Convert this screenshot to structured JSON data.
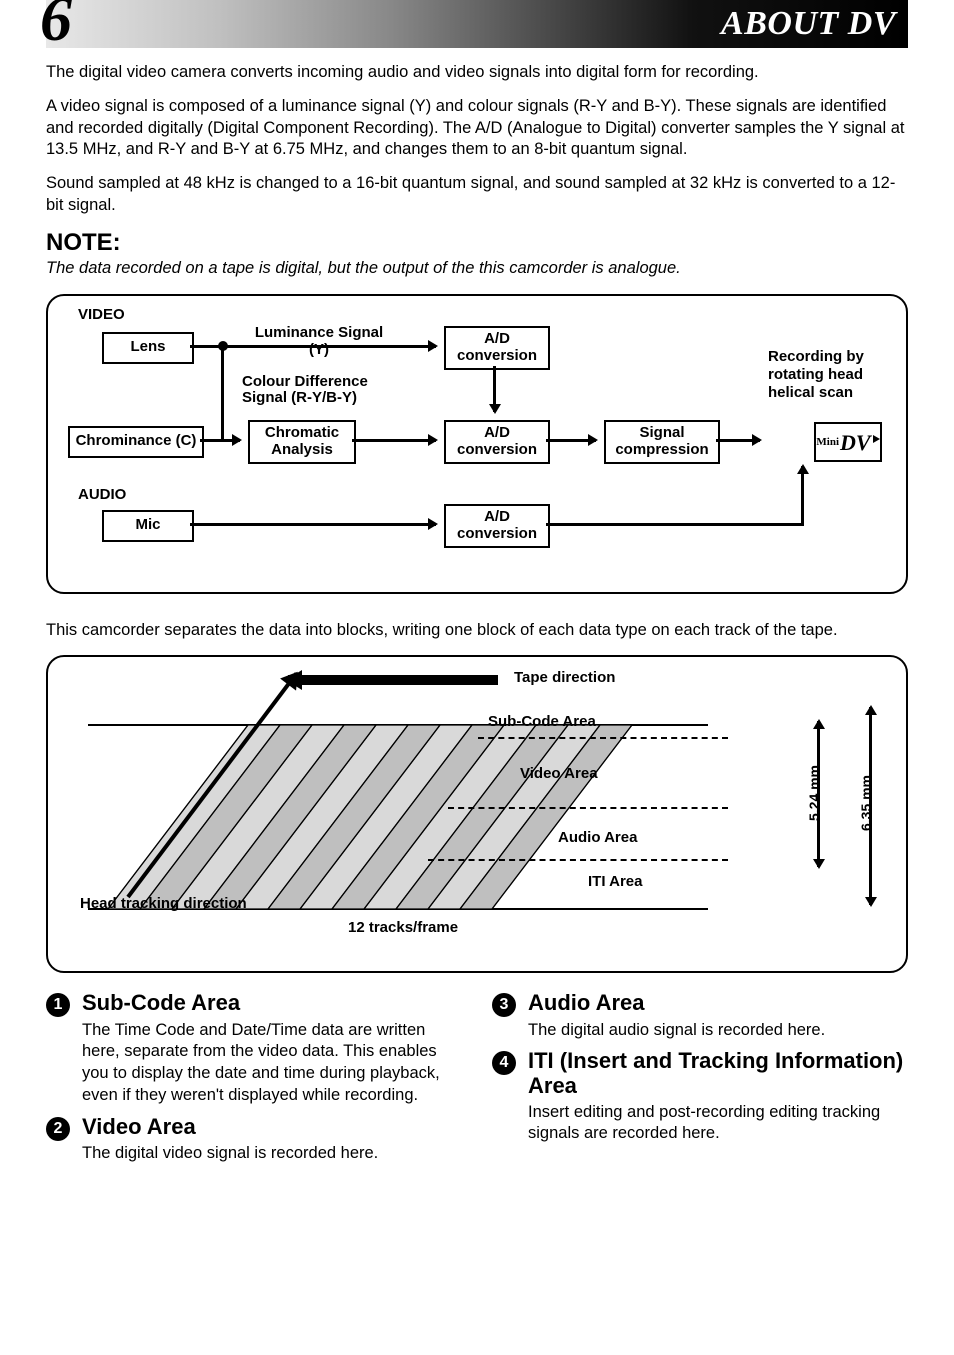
{
  "header": {
    "page_number": "6",
    "title": "ABOUT DV"
  },
  "intro": {
    "p1": "The digital video camera converts incoming audio and video signals into digital form for recording.",
    "p2": "A video signal is composed of a luminance signal (Y) and colour signals (R-Y and B-Y). These signals are identified and recorded digitally (Digital Component Recording). The A/D (Analogue to Digital) converter samples the Y signal at 13.5 MHz, and R-Y and B-Y at 6.75 MHz, and changes them to an 8-bit quantum signal.",
    "p3": "Sound sampled at 48 kHz is changed to a 16-bit quantum signal, and sound sampled at 32 kHz is converted to a 12-bit signal."
  },
  "note": {
    "heading": "NOTE:",
    "body": "The data recorded on a tape is digital, but the output of the this camcorder is analogue."
  },
  "diagram1": {
    "video_label": "VIDEO",
    "audio_label": "AUDIO",
    "lens": "Lens",
    "chrominance": "Chrominance (C)",
    "mic": "Mic",
    "luminance": "Luminance Signal (Y)",
    "colour_diff": "Colour Difference Signal (R-Y/B-Y)",
    "chromatic": "Chromatic Analysis",
    "ad1": "A/D conversion",
    "ad2": "A/D conversion",
    "ad3": "A/D conversion",
    "sigcomp": "Signal compression",
    "recording": "Recording by rotating head helical scan",
    "minidv_prefix": "Mini"
  },
  "mid_text": "This camcorder separates the data into blocks, writing one block of each data type on each track of the tape.",
  "diagram2": {
    "tape_direction": "Tape direction",
    "subcode": "Sub-Code Area",
    "video": "Video Area",
    "audio": "Audio Area",
    "iti": "ITI Area",
    "head_tracking": "Head tracking direction",
    "tracks": "12 tracks/frame",
    "dim_inner": "5.24 mm",
    "dim_outer": "6.35 mm"
  },
  "sections": {
    "s1": {
      "num": "1",
      "title": "Sub-Code Area",
      "body": "The Time Code and Date/Time data are written here, separate from the video data. This enables you to display the date and time during playback, even if they weren't displayed while recording."
    },
    "s2": {
      "num": "2",
      "title": "Video Area",
      "body": "The digital video signal is recorded here."
    },
    "s3": {
      "num": "3",
      "title": "Audio Area",
      "body": "The digital audio signal is recorded here."
    },
    "s4": {
      "num": "4",
      "title": "ITI (Insert and Tracking Information) Area",
      "body": "Insert editing and post-recording editing tracking signals are recorded here."
    }
  }
}
